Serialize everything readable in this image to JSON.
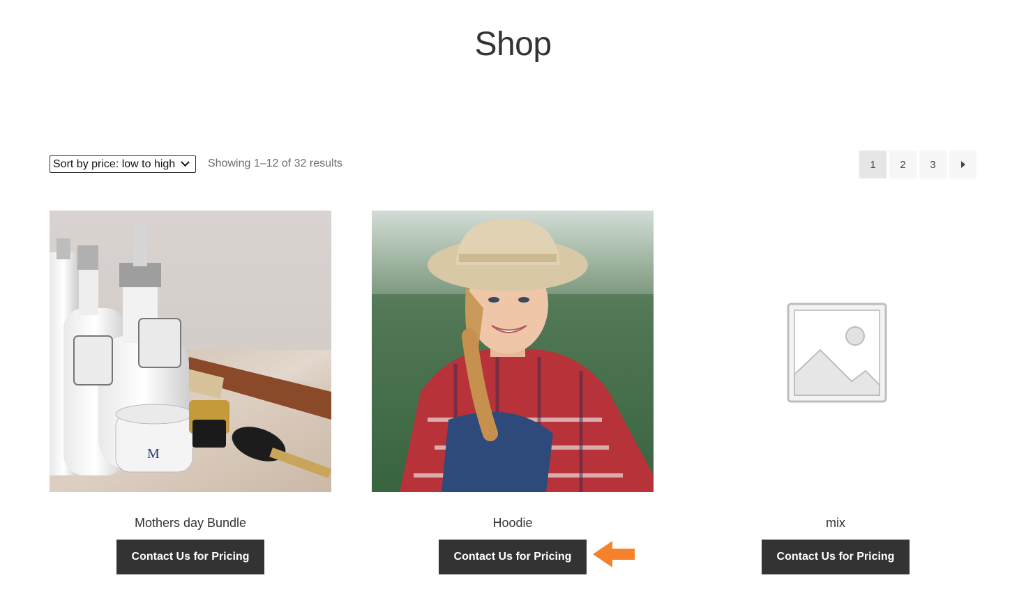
{
  "page": {
    "title": "Shop"
  },
  "toolbar": {
    "sort_value": "Sort by price: low to high",
    "result_count": "Showing 1–12 of 32 results"
  },
  "pagination": {
    "pages": [
      "1",
      "2",
      "3"
    ],
    "current": "1",
    "next_icon": "next-arrow-icon"
  },
  "products": [
    {
      "name": "Mothers day Bundle",
      "button": "Contact Us for Pricing",
      "image": "cosmetics-photo"
    },
    {
      "name": "Hoodie",
      "button": "Contact Us for Pricing",
      "image": "woman-in-hat-photo"
    },
    {
      "name": "mix",
      "button": "Contact Us for Pricing",
      "image": "placeholder-image-icon"
    }
  ],
  "colors": {
    "button_bg": "#333333",
    "accent_arrow": "#F5822A"
  }
}
